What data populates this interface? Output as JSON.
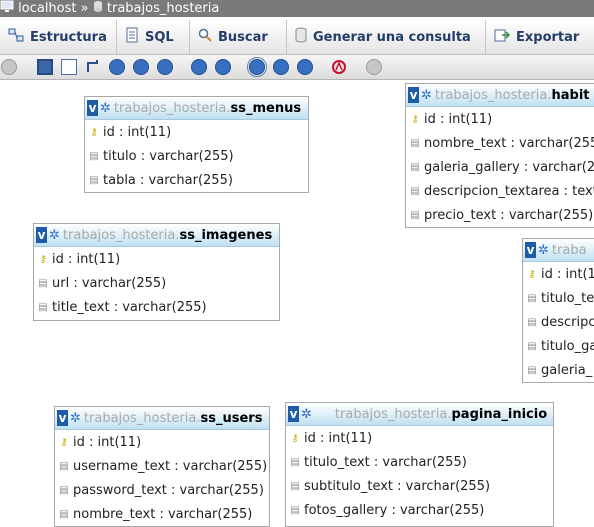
{
  "breadcrumb": {
    "server": "localhost",
    "separator": "»",
    "database": "trabajos_hosteria"
  },
  "tabs": [
    {
      "label": "Estructura",
      "icon": "structure-icon"
    },
    {
      "label": "SQL",
      "icon": "sql-icon"
    },
    {
      "label": "Buscar",
      "icon": "search-icon"
    },
    {
      "label": "Generar una consulta",
      "icon": "query-icon"
    },
    {
      "label": "Exportar",
      "icon": "export-icon"
    }
  ],
  "toolbar_icons": [
    "hide-icon",
    "save-icon",
    "page-icon",
    "relation-icon",
    "zoom-in-icon",
    "zoom-out-icon",
    "help-icon",
    "angular-link-icon",
    "direct-link-icon",
    "snap-to-grid-icon",
    "small-big-icon",
    "toggle-small-big-icon",
    "pdf-icon",
    "close-icon"
  ],
  "colors": {
    "accent": "#1e5ca8",
    "header_gradient_end": "#bfe0f3",
    "db_prefix": "#a9a9a9",
    "tab_text": "#233d69"
  },
  "db_prefix": "trabajos_hosteria.",
  "tables": [
    {
      "name": "ss_menus",
      "columns": [
        {
          "key": true,
          "text": "id : int(11)"
        },
        {
          "key": false,
          "text": "titulo : varchar(255)"
        },
        {
          "key": false,
          "text": "tabla : varchar(255)"
        }
      ]
    },
    {
      "name": "habit",
      "columns": [
        {
          "key": true,
          "text": "id : int(11)"
        },
        {
          "key": false,
          "text": "nombre_text : varchar(255"
        },
        {
          "key": false,
          "text": "galeria_gallery : varchar(2"
        },
        {
          "key": false,
          "text": "descripcion_textarea : text"
        },
        {
          "key": false,
          "text": "precio_text : varchar(255)"
        }
      ]
    },
    {
      "name": "ss_imagenes",
      "columns": [
        {
          "key": true,
          "text": "id : int(11)"
        },
        {
          "key": false,
          "text": "url : varchar(255)"
        },
        {
          "key": false,
          "text": "title_text : varchar(255)"
        }
      ]
    },
    {
      "prefix": "traba",
      "name": "",
      "columns": [
        {
          "key": true,
          "text": "id : int(1"
        },
        {
          "key": false,
          "text": "titulo_te"
        },
        {
          "key": false,
          "text": "descripc"
        },
        {
          "key": false,
          "text": "titulo_ga"
        },
        {
          "key": false,
          "text": "galeria_"
        }
      ]
    },
    {
      "name": "ss_users",
      "columns": [
        {
          "key": true,
          "text": "id : int(11)"
        },
        {
          "key": false,
          "text": "username_text : varchar(255)"
        },
        {
          "key": false,
          "text": "password_text : varchar(255)"
        },
        {
          "key": false,
          "text": "nombre_text : varchar(255)"
        }
      ]
    },
    {
      "name": "pagina_inicio",
      "columns": [
        {
          "key": true,
          "text": "id : int(11)"
        },
        {
          "key": false,
          "text": "titulo_text : varchar(255)"
        },
        {
          "key": false,
          "text": "subtitulo_text : varchar(255)"
        },
        {
          "key": false,
          "text": "fotos_gallery : varchar(255)"
        }
      ]
    }
  ]
}
